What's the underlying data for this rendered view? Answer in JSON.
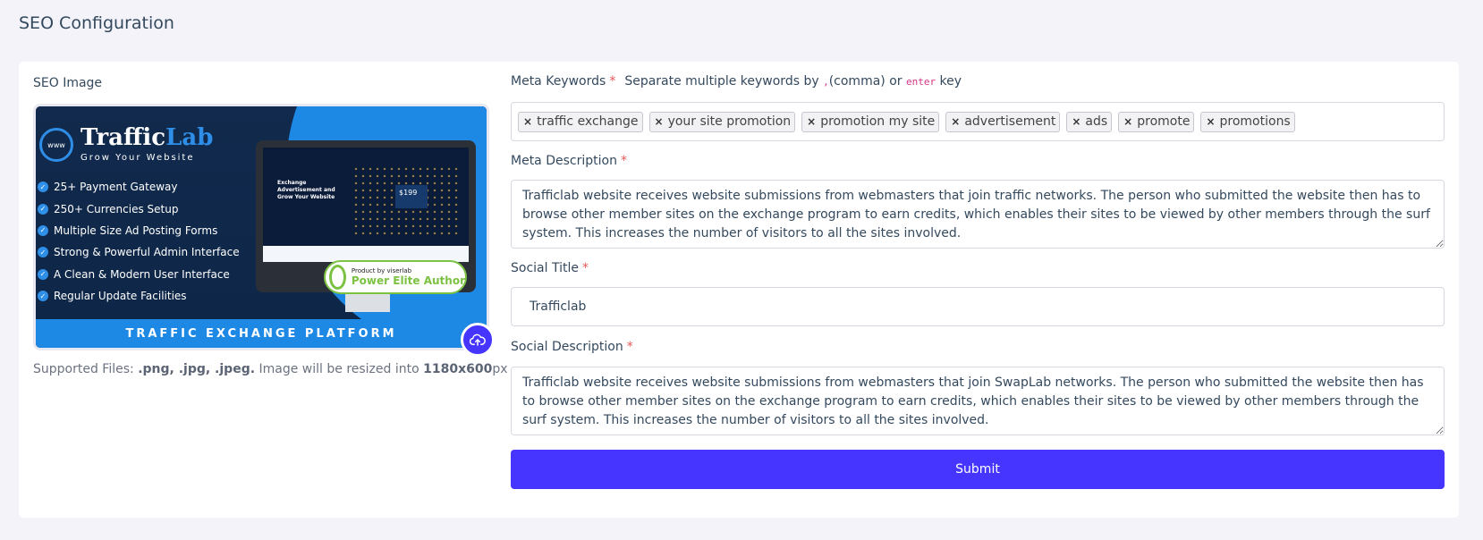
{
  "page": {
    "title": "SEO Configuration"
  },
  "seo_image": {
    "label": "SEO Image",
    "banner": {
      "brand_first": "Traffic",
      "brand_second": "Lab",
      "globe_text": "www",
      "tagline": "Grow Your Website",
      "features": [
        "25+ Payment Gateway",
        "250+ Currencies Setup",
        "Multiple Size Ad Posting Forms",
        "Strong & Powerful Admin Interface",
        "A Clean & Modern User Interface",
        "Regular Update Facilities"
      ],
      "screen_headline": "Exchange Advertisement and Grow Your Website",
      "screen_price": "$199",
      "badge_top": "Product by viserlab",
      "badge_main": "Power Elite Author",
      "footer": "TRAFFIC EXCHANGE PLATFORM"
    },
    "support_prefix": "Supported Files: ",
    "support_types": ".png, .jpg, .jpeg.",
    "support_mid": " Image will be resized into ",
    "support_size": "1180x600",
    "support_unit": "px"
  },
  "meta_keywords": {
    "label": "Meta Keywords",
    "required_mark": "*",
    "hint_before": "Separate multiple keywords by ",
    "hint_code1": ",",
    "hint_mid": "(comma) or ",
    "hint_code2": "enter",
    "hint_after": " key",
    "tags": [
      "traffic exchange",
      "your site promotion",
      "promotion my site",
      "advertisement",
      "ads",
      "promote",
      "promotions"
    ]
  },
  "meta_description": {
    "label": "Meta Description",
    "required_mark": "*",
    "value": "Trafficlab website receives website submissions from webmasters that join traffic networks. The person who submitted the website then has to browse other member sites on the exchange program to earn credits, which enables their sites to be viewed by other members through the surf system. This increases the number of visitors to all the sites involved."
  },
  "social_title": {
    "label": "Social Title",
    "required_mark": "*",
    "value": "Trafficlab"
  },
  "social_description": {
    "label": "Social Description",
    "required_mark": "*",
    "value": "Trafficlab website receives website submissions from webmasters that join SwapLab networks. The person who submitted the website then has to browse other member sites on the exchange program to earn credits, which enables their sites to be viewed by other members through the surf system. This increases the number of visitors to all the sites involved."
  },
  "submit": {
    "label": "Submit"
  },
  "colors": {
    "primary": "#4634ff",
    "required": "#ea5455",
    "banner_blue": "#1e88e5"
  },
  "icons": {
    "upload": "cloud-upload-icon",
    "tag_remove": "close-icon"
  }
}
